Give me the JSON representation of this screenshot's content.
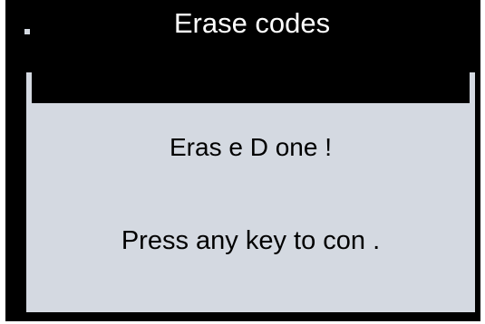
{
  "window": {
    "title": "Erase codes",
    "marker_icon": "square-bullet-icon"
  },
  "dialog": {
    "line1": "Eras e D one !",
    "line2": "Press any key to con ."
  },
  "colors": {
    "frame": "#000000",
    "panel": "#d4d9e1",
    "title_text": "#ffffff",
    "body_text": "#000000"
  }
}
